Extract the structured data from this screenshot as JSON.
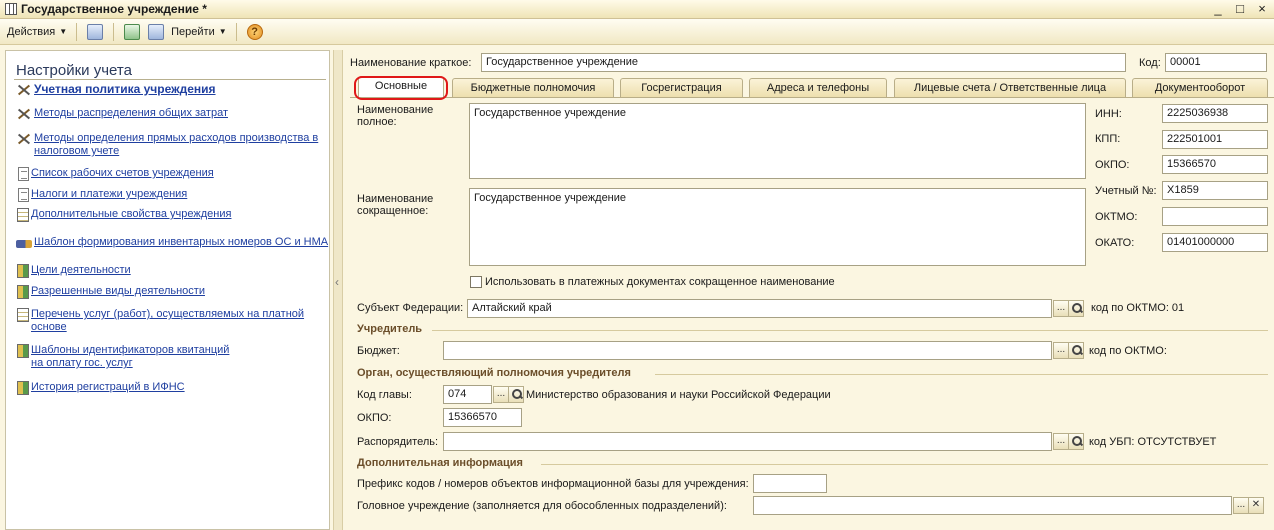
{
  "window": {
    "title": "Государственное учреждение *",
    "controls": [
      "_",
      "□",
      "×"
    ]
  },
  "toolbar": {
    "actions_label": "Действия",
    "goto_label": "Перейти",
    "help": "?"
  },
  "left_panel": {
    "title": "Настройки учета",
    "items": [
      {
        "label": "Учетная политика учреждения",
        "icon": "tools-icon"
      },
      {
        "label": "Методы распределения общих затрат",
        "icon": "tools-icon"
      },
      {
        "label": "Методы определения прямых расходов производства в",
        "label2": "налоговом учете",
        "icon": "tools-icon"
      },
      {
        "label": "Список рабочих счетов учреждения",
        "icon": "document-icon"
      },
      {
        "label": "Налоги и платежи учреждения",
        "icon": "document-icon"
      },
      {
        "label": "Дополнительные свойства учреждения",
        "icon": "properties-icon"
      },
      {
        "label": "Шаблон формирования инвентарных номеров ОС и НМА",
        "icon": "truck-icon"
      },
      {
        "label": "Цели деятельности",
        "icon": "list-icon"
      },
      {
        "label": "Разрешенные виды деятельности",
        "icon": "list-icon"
      },
      {
        "label": "Перечень услуг (работ), осуществляемых на платной",
        "label2": "основе",
        "icon": "catalog-icon"
      },
      {
        "label": "Шаблоны идентификаторов квитанций",
        "label2": "на оплату гос. услуг",
        "icon": "list-icon"
      },
      {
        "label": "История регистраций в ИФНС",
        "icon": "list-icon"
      }
    ]
  },
  "header": {
    "short_name_label": "Наименование краткое:",
    "short_name_value": "Государственное учреждение",
    "code_label": "Код:",
    "code_value": "00001"
  },
  "tabs": [
    {
      "label": "Основные",
      "active": true
    },
    {
      "label": "Бюджетные полномочия"
    },
    {
      "label": "Госрегистрация"
    },
    {
      "label": "Адреса и телефоны"
    },
    {
      "label": "Лицевые счета / Ответственные лица"
    },
    {
      "label": "Документооборот"
    }
  ],
  "main": {
    "full_name_label1": "Наименование",
    "full_name_label2": "полное:",
    "full_name_value": "Государственное учреждение",
    "abbr_name_label1": "Наименование",
    "abbr_name_label2": "сокращенное:",
    "abbr_name_value": "Государственное учреждение",
    "use_abbr_label": "Использовать в платежных документах сокращенное наименование",
    "inn_label": "ИНН:",
    "inn_value": "2225036938",
    "kpp_label": "КПП:",
    "kpp_value": "222501001",
    "okpo_label": "ОКПО:",
    "okpo_value": "15366570",
    "acc_no_label": "Учетный №:",
    "acc_no_value": "Х1859",
    "oktmo_label": "ОКТМО:",
    "oktmo_value": "",
    "okato_label": "ОКАТО:",
    "okato_value": "01401000000",
    "subject_label": "Субъект Федерации:",
    "subject_value": "Алтайский край",
    "subject_oktmo": "код по ОКТМО: 01"
  },
  "founder": {
    "section": "Учредитель",
    "budget_label": "Бюджет:",
    "budget_value": "",
    "budget_oktmo": "код по ОКТМО:"
  },
  "authority": {
    "section": "Орган, осуществляющий полномочия учредителя",
    "head_code_label": "Код главы:",
    "head_code_value": "074",
    "head_code_name": "Министерство образования и науки Российской Федерации",
    "okpo_label": "ОКПО:",
    "okpo_value": "15366570",
    "manager_label": "Распорядитель:",
    "manager_value": "",
    "ubp_text": "код УБП: ОТСУТСТВУЕТ"
  },
  "extra": {
    "section": "Дополнительная информация",
    "prefix_label": "Префикс кодов / номеров объектов информационной базы для учреждения:",
    "prefix_value": "",
    "head_inst_label": "Головное учреждение (заполняется для обособленных подразделений):",
    "head_inst_value": ""
  }
}
